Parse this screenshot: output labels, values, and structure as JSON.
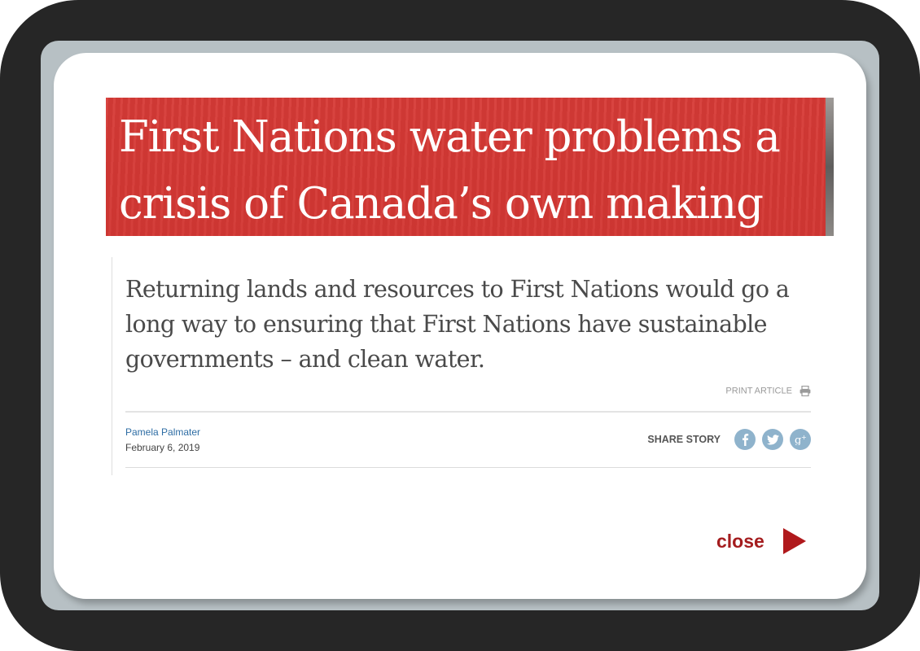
{
  "article": {
    "headline_line1": "First Nations water problems a",
    "headline_line2": "crisis of Canada’s own making",
    "subtitle": "Returning lands and resources to First Nations would go a long way to ensuring that First Nations have sustainable governments – and clean water.",
    "print_label": "PRINT ARTICLE",
    "author": "Pamela Palmater",
    "date": "February 6, 2019",
    "share_label": "SHARE STORY",
    "share_buttons": [
      {
        "icon": "facebook-icon",
        "glyph": "f"
      },
      {
        "icon": "twitter-icon",
        "glyph": "🐦"
      },
      {
        "icon": "google-plus-icon",
        "glyph": "g+"
      }
    ]
  },
  "dialog": {
    "close_label": "close"
  },
  "colors": {
    "banner": "#d63a36",
    "accent": "#a41c1e",
    "link": "#2e6da4",
    "share_button": "#8fb3cc"
  }
}
